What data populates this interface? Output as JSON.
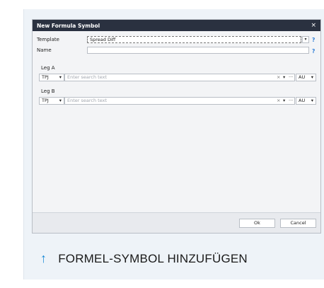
{
  "dialog": {
    "title": "New Formula Symbol",
    "close_glyph": "×"
  },
  "form": {
    "template_label": "Template",
    "template_value": "Spread Diff",
    "name_label": "Name",
    "name_value": "",
    "help_glyph": "?"
  },
  "legs": [
    {
      "label": "Leg A",
      "exchange": "TPJ",
      "search_placeholder": "Enter search text",
      "unit": "AU"
    },
    {
      "label": "Leg B",
      "exchange": "TPJ",
      "search_placeholder": "Enter search text",
      "unit": "AU"
    }
  ],
  "icons": {
    "clear": "×",
    "dropdown": "▾",
    "more": "···"
  },
  "buttons": {
    "ok": "Ok",
    "cancel": "Cancel"
  },
  "caption": {
    "arrow": "↑",
    "text": "FORMEL-SYMBOL HINZUFÜGEN"
  },
  "colors": {
    "titlebar": "#2a3140",
    "help": "#2a7bd6",
    "caption_arrow": "#1a8ad6"
  }
}
